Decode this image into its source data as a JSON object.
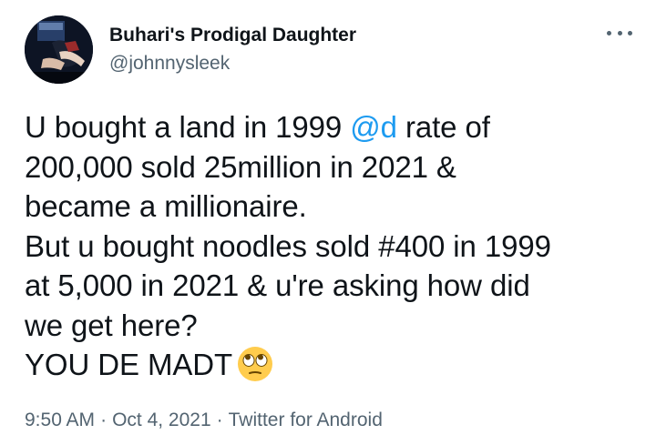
{
  "author": {
    "display_name": "Buhari's Prodigal Daughter",
    "handle": "@johnnysleek",
    "avatar_icon": "profile-photo"
  },
  "menu": {
    "icon": "more-horizontal-icon"
  },
  "tweet": {
    "line1_before": "U bought a land in 1999 ",
    "line1_mention": "@d",
    "line1_after": " rate of",
    "line2": "200,000 sold 25million in 2021 &",
    "line3": "became a millionaire.",
    "line4": "But u bought noodles sold #400 in 1999",
    "line5": "at 5,000 in 2021 & u're asking how did",
    "line6": "we get here?",
    "line7": "YOU DE MADT",
    "emoji": "face-with-rolling-eyes"
  },
  "meta": {
    "time": "9:50 AM",
    "date": "Oct 4, 2021",
    "source": "Twitter for Android",
    "separator": "·"
  },
  "colors": {
    "text": "#0f1419",
    "secondary": "#536471",
    "link": "#1d9bf0"
  }
}
